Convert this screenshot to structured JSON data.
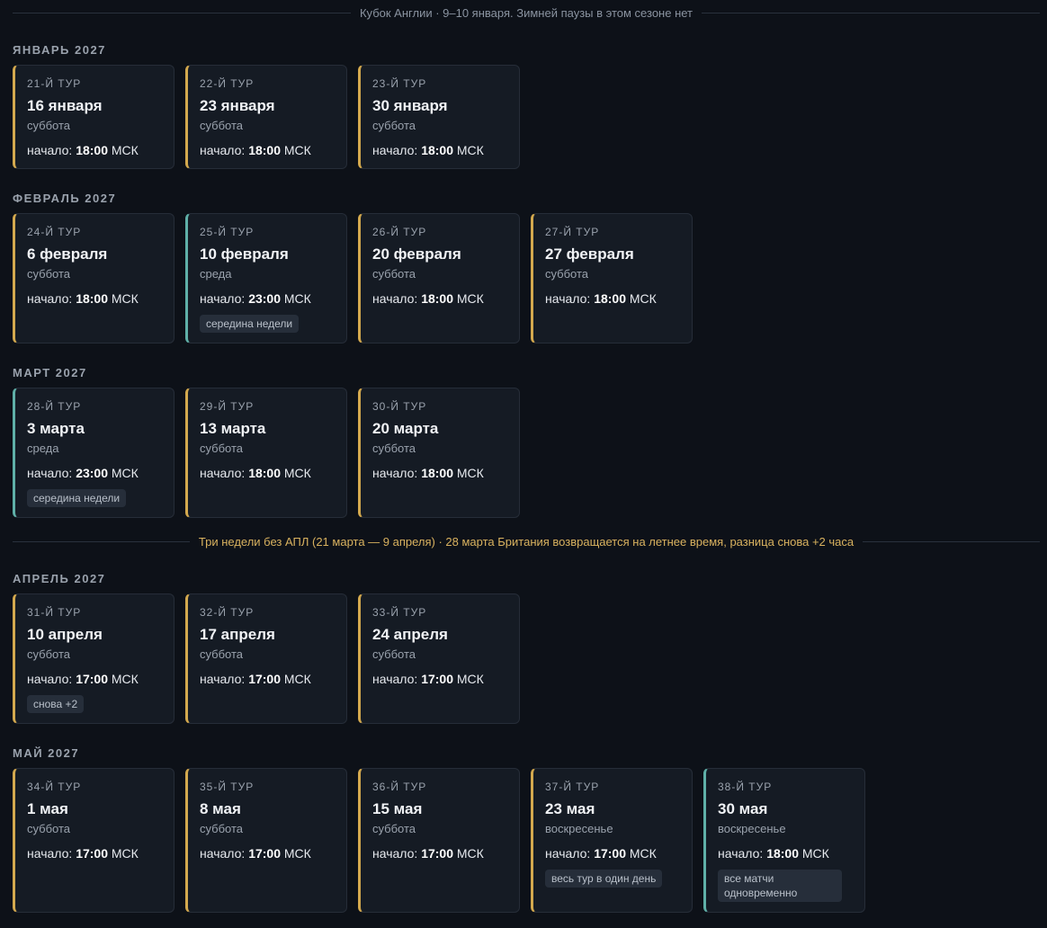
{
  "top_note": "Кубок Англии · 9–10 января. Зимней паузы в этом сезоне нет",
  "mid_note": "Три недели без АПЛ (21 марта — 9 апреля) · 28 марта Британия возвращается на летнее время, разница снова +2 часа",
  "start_prefix": "начало:",
  "tz": "МСК",
  "colors": {
    "accent_gold": "#d4a94e",
    "accent_teal": "#5fb0a8",
    "background": "#0d1118",
    "card": "#151b24"
  },
  "months": [
    {
      "label": "ЯНВАРЬ 2027",
      "rounds": [
        {
          "round": "21-Й ТУР",
          "date": "16 января",
          "dow": "суббота",
          "time": "18:00",
          "accent": "gold",
          "badge": ""
        },
        {
          "round": "22-Й ТУР",
          "date": "23 января",
          "dow": "суббота",
          "time": "18:00",
          "accent": "gold",
          "badge": ""
        },
        {
          "round": "23-Й ТУР",
          "date": "30 января",
          "dow": "суббота",
          "time": "18:00",
          "accent": "gold",
          "badge": ""
        }
      ]
    },
    {
      "label": "ФЕВРАЛЬ 2027",
      "rounds": [
        {
          "round": "24-Й ТУР",
          "date": "6 февраля",
          "dow": "суббота",
          "time": "18:00",
          "accent": "gold",
          "badge": ""
        },
        {
          "round": "25-Й ТУР",
          "date": "10 февраля",
          "dow": "среда",
          "time": "23:00",
          "accent": "teal",
          "badge": "середина недели"
        },
        {
          "round": "26-Й ТУР",
          "date": "20 февраля",
          "dow": "суббота",
          "time": "18:00",
          "accent": "gold",
          "badge": ""
        },
        {
          "round": "27-Й ТУР",
          "date": "27 февраля",
          "dow": "суббота",
          "time": "18:00",
          "accent": "gold",
          "badge": ""
        }
      ]
    },
    {
      "label": "МАРТ 2027",
      "rounds": [
        {
          "round": "28-Й ТУР",
          "date": "3 марта",
          "dow": "среда",
          "time": "23:00",
          "accent": "teal",
          "badge": "середина недели"
        },
        {
          "round": "29-Й ТУР",
          "date": "13 марта",
          "dow": "суббота",
          "time": "18:00",
          "accent": "gold",
          "badge": ""
        },
        {
          "round": "30-Й ТУР",
          "date": "20 марта",
          "dow": "суббота",
          "time": "18:00",
          "accent": "gold",
          "badge": ""
        }
      ]
    },
    {
      "label": "АПРЕЛЬ 2027",
      "rounds": [
        {
          "round": "31-Й ТУР",
          "date": "10 апреля",
          "dow": "суббота",
          "time": "17:00",
          "accent": "gold",
          "badge": "снова +2"
        },
        {
          "round": "32-Й ТУР",
          "date": "17 апреля",
          "dow": "суббота",
          "time": "17:00",
          "accent": "gold",
          "badge": ""
        },
        {
          "round": "33-Й ТУР",
          "date": "24 апреля",
          "dow": "суббота",
          "time": "17:00",
          "accent": "gold",
          "badge": ""
        }
      ]
    },
    {
      "label": "МАЙ 2027",
      "rounds": [
        {
          "round": "34-Й ТУР",
          "date": "1 мая",
          "dow": "суббота",
          "time": "17:00",
          "accent": "gold",
          "badge": ""
        },
        {
          "round": "35-Й ТУР",
          "date": "8 мая",
          "dow": "суббота",
          "time": "17:00",
          "accent": "gold",
          "badge": ""
        },
        {
          "round": "36-Й ТУР",
          "date": "15 мая",
          "dow": "суббота",
          "time": "17:00",
          "accent": "gold",
          "badge": ""
        },
        {
          "round": "37-Й ТУР",
          "date": "23 мая",
          "dow": "воскресенье",
          "time": "17:00",
          "accent": "gold",
          "badge": "весь тур в один день"
        },
        {
          "round": "38-Й ТУР",
          "date": "30 мая",
          "dow": "воскресенье",
          "time": "18:00",
          "accent": "teal",
          "badge": "все матчи одновременно"
        }
      ]
    }
  ]
}
